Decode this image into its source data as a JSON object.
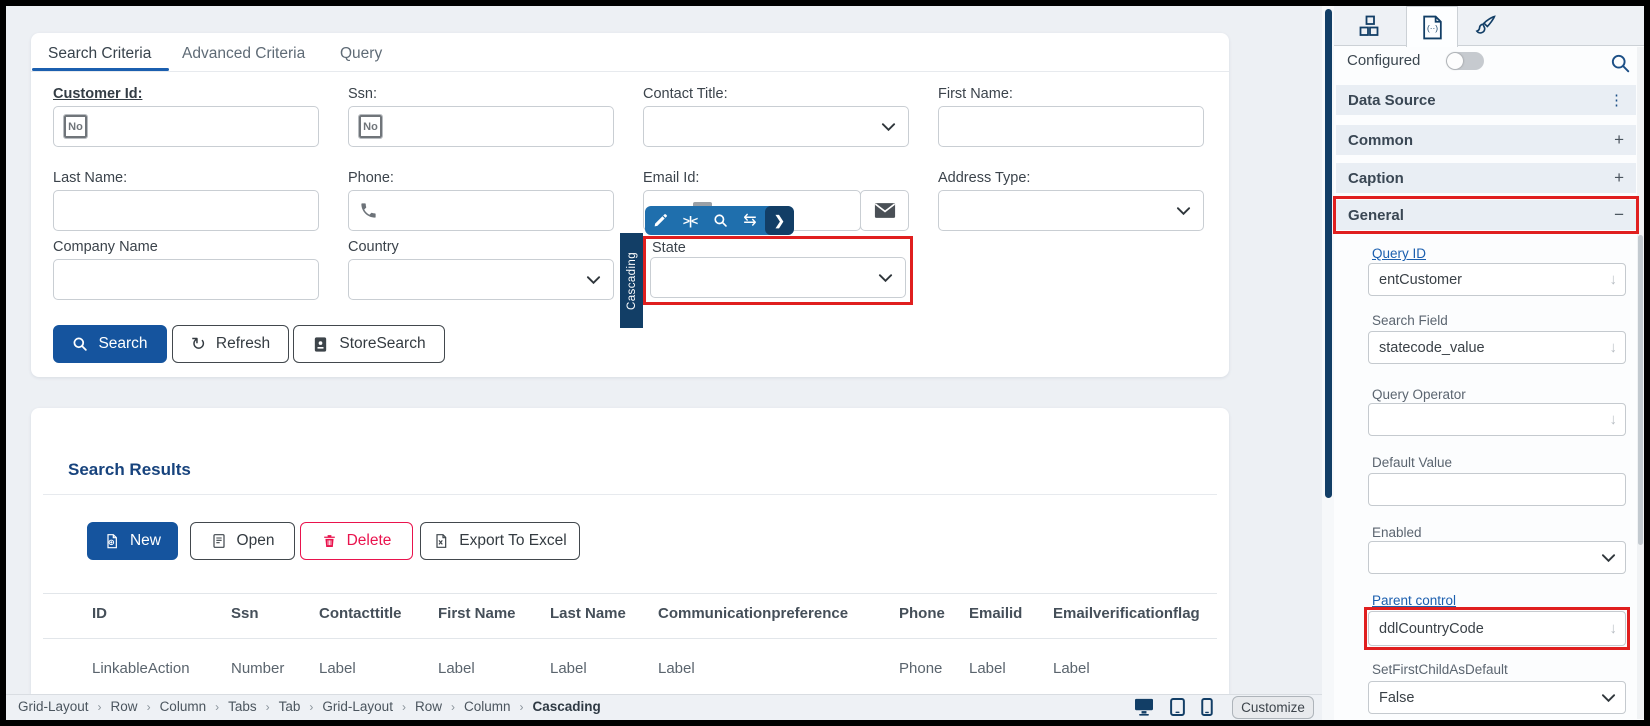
{
  "colors": {
    "primary_blue": "#15549e",
    "navy": "#123e66",
    "toolbar_blue": "#1f6fad",
    "link_blue": "#1b5faf",
    "highlight_red": "#e01f1f",
    "delete_red": "#e9134d"
  },
  "icons": {
    "swap": "⇆",
    "align_center": ">|<",
    "chevron_right": "❯",
    "refresh": "↻",
    "kebab": "⋮",
    "plus": "+",
    "minus": "−",
    "down_arrow": "↓",
    "breadcrumb_sep": "›"
  },
  "form_card": {
    "tabs": [
      {
        "label": "Search Criteria",
        "active": true
      },
      {
        "label": "Advanced Criteria",
        "active": false
      },
      {
        "label": "Query",
        "active": false
      }
    ],
    "fields": {
      "customer_id": {
        "label": "Customer Id:",
        "badge": "No"
      },
      "ssn": {
        "label": "Ssn:",
        "badge": "No"
      },
      "contact_title": {
        "label": "Contact Title:"
      },
      "first_name": {
        "label": "First Name:"
      },
      "last_name": {
        "label": "Last Name:"
      },
      "phone": {
        "label": "Phone:"
      },
      "email_id": {
        "label": "Email Id:"
      },
      "address_type": {
        "label": "Address Type:"
      },
      "company_name": {
        "label": "Company Name"
      },
      "country": {
        "label": "Country"
      },
      "state": {
        "label": "State"
      }
    },
    "cascading_tag": "Cascading",
    "buttons": {
      "search": "Search",
      "refresh": "Refresh",
      "store_search": "StoreSearch"
    }
  },
  "results_card": {
    "title": "Search Results",
    "buttons": {
      "new": "New",
      "open": "Open",
      "delete": "Delete",
      "export": "Export To Excel"
    },
    "table": {
      "headers": [
        "ID",
        "Ssn",
        "Contacttitle",
        "First Name",
        "Last Name",
        "Communicationpreference",
        "Phone",
        "Emailid",
        "Emailverificationflag"
      ],
      "row": [
        "LinkableAction",
        "Number",
        "Label",
        "Label",
        "Label",
        "Label",
        "Phone",
        "Label",
        "Label"
      ]
    }
  },
  "breadcrumb": {
    "items": [
      "Grid-Layout",
      "Row",
      "Column",
      "Tabs",
      "Tab",
      "Grid-Layout",
      "Row",
      "Column",
      "Cascading"
    ]
  },
  "footer": {
    "customize_label": "Customize"
  },
  "panel": {
    "configured_label": "Configured",
    "sections": [
      {
        "label": "Data Source",
        "action": "kebab"
      },
      {
        "label": "Common",
        "action": "plus"
      },
      {
        "label": "Caption",
        "action": "plus"
      },
      {
        "label": "General",
        "action": "minus",
        "highlighted": true
      }
    ],
    "fields": {
      "query_id": {
        "label": "Query ID",
        "value": "entCustomer"
      },
      "search_field": {
        "label": "Search Field",
        "value": "statecode_value"
      },
      "query_operator": {
        "label": "Query Operator",
        "value": ""
      },
      "default_value": {
        "label": "Default Value",
        "value": ""
      },
      "enabled": {
        "label": "Enabled",
        "value": ""
      },
      "parent_control": {
        "label": "Parent control",
        "value": "ddlCountryCode"
      },
      "set_first_child": {
        "label": "SetFirstChildAsDefault",
        "value": "False"
      }
    }
  }
}
